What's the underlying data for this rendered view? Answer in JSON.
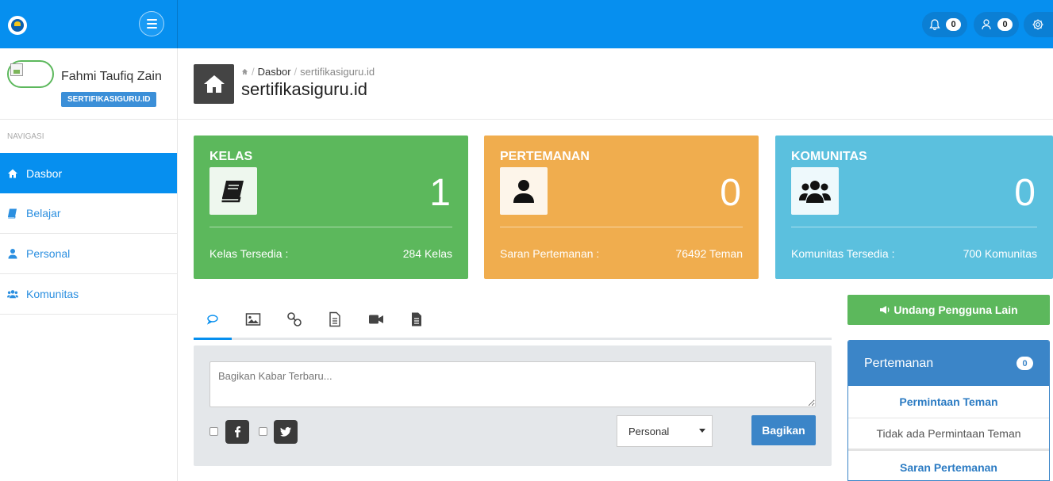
{
  "colors": {
    "primary": "#068fef",
    "green": "#5cb85c",
    "orange": "#f0ad4e",
    "cyan": "#5bc0de",
    "button_blue": "#3b85c8"
  },
  "topbar": {
    "menu_icon": "hamburger-icon",
    "notifications": {
      "icon": "bell-icon",
      "count": "0"
    },
    "requests": {
      "icon": "user-request-icon",
      "count": "0"
    },
    "settings": {
      "icon": "gear-icon"
    }
  },
  "sidebar": {
    "profile": {
      "name": "Fahmi Taufiq Zain",
      "badge": "SERTIFIKASIGURU.ID"
    },
    "nav_title": "NAVIGASI",
    "items": [
      {
        "label": "Dasbor",
        "icon": "home-icon",
        "active": true
      },
      {
        "label": "Belajar",
        "icon": "book-icon",
        "active": false
      },
      {
        "label": "Personal",
        "icon": "user-icon",
        "active": false
      },
      {
        "label": "Komunitas",
        "icon": "users-icon",
        "active": false
      }
    ]
  },
  "header": {
    "breadcrumb": {
      "home": "Dasbor",
      "current": "sertifikasiguru.id",
      "sep": "/"
    },
    "title": "sertifikasiguru.id"
  },
  "cards": [
    {
      "title": "KELAS",
      "value": "1",
      "footer_label": "Kelas Tersedia :",
      "footer_value": "284 Kelas",
      "icon": "book-icon"
    },
    {
      "title": "PERTEMANAN",
      "value": "0",
      "footer_label": "Saran Pertemanan :",
      "footer_value": "76492 Teman",
      "icon": "user-icon"
    },
    {
      "title": "KOMUNITAS",
      "value": "0",
      "footer_label": "Komunitas Tersedia :",
      "footer_value": "700 Komunitas",
      "icon": "users-icon"
    }
  ],
  "post": {
    "tabs": [
      "comment-icon",
      "image-icon",
      "link-icon",
      "document-icon",
      "video-icon",
      "file-icon"
    ],
    "placeholder": "Bagikan Kabar Terbaru...",
    "visibility": "Personal",
    "share_label": "Bagikan"
  },
  "right": {
    "invite_label": "Undang Pengguna Lain",
    "panel_title": "Pertemanan",
    "panel_count": "0",
    "requests_label": "Permintaan Teman",
    "no_requests": "Tidak ada Permintaan Teman",
    "suggestions_label": "Saran Pertemanan"
  }
}
